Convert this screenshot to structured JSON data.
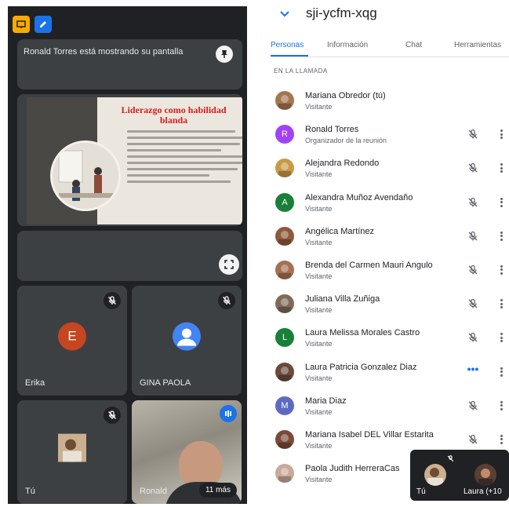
{
  "left_panel": {
    "presenting_banner": "Ronald Torres está mostrando su pantalla",
    "slide_title": "Liderazgo como habilidad blanda",
    "tiles": [
      {
        "name": "Erika",
        "initial": "E",
        "color": "#c5461f"
      },
      {
        "name": "GINA PAOLA",
        "initial": "",
        "color": "#4285f4"
      },
      {
        "name": "Tú",
        "initial": "",
        "color": "#b49270"
      },
      {
        "name": "Ronald",
        "initial": "",
        "color": "#9a9488"
      }
    ],
    "more_participants": "11 más",
    "colors": {
      "background": "#202124",
      "tile": "#3c4043",
      "accent": "#1a73e8"
    }
  },
  "right_panel": {
    "meeting_code": "sji-ycfm-xqg",
    "tabs": [
      "Personas",
      "Información",
      "Chat",
      "Herramientas"
    ],
    "active_tab": "Personas",
    "section_label": "EN LA LLAMADA",
    "participants": [
      {
        "name": "Mariana Obredor (tú)",
        "role": "Visitante",
        "initial": "",
        "avatar_color": "#a3764f",
        "action": "none"
      },
      {
        "name": "Ronald Torres",
        "role": "Organizador de la reunión",
        "initial": "R",
        "avatar_color": "#a142f4",
        "action": "muted"
      },
      {
        "name": "Alejandra Redondo",
        "role": "Visitante",
        "initial": "",
        "avatar_color": "#c79a4a",
        "action": "muted"
      },
      {
        "name": "Alexandra Muñoz Avendaño",
        "role": "Visitante",
        "initial": "A",
        "avatar_color": "#188038",
        "action": "muted"
      },
      {
        "name": "Angélica Martínez",
        "role": "Visitante",
        "initial": "",
        "avatar_color": "#8d5a3b",
        "action": "muted"
      },
      {
        "name": "Brenda del Carmen Mauri Angulo",
        "role": "Visitante",
        "initial": "",
        "avatar_color": "#a56f52",
        "action": "muted"
      },
      {
        "name": "Juliana Villa Zuñiga",
        "role": "Visitante",
        "initial": "",
        "avatar_color": "#7f6a5a",
        "action": "muted"
      },
      {
        "name": "Laura Melissa Morales Castro",
        "role": "Visitante",
        "initial": "L",
        "avatar_color": "#188038",
        "action": "muted"
      },
      {
        "name": "Laura Patricia Gonzalez Diaz",
        "role": "Visitante",
        "initial": "",
        "avatar_color": "#6b4a3a",
        "action": "speaking"
      },
      {
        "name": "Maria Diaz",
        "role": "Visitante",
        "initial": "M",
        "avatar_color": "#5c6bc0",
        "action": "muted"
      },
      {
        "name": "Mariana Isabel DEL Villar Estarita",
        "role": "Visitante",
        "initial": "",
        "avatar_color": "#7a4a38",
        "action": "muted"
      },
      {
        "name": "Paola Judith HerreraCas",
        "role": "Visitante",
        "initial": "",
        "avatar_color": "#c9a99a",
        "action": "none"
      }
    ]
  },
  "pip": {
    "self_label": "Tú",
    "other_label": "Laura (+10"
  }
}
